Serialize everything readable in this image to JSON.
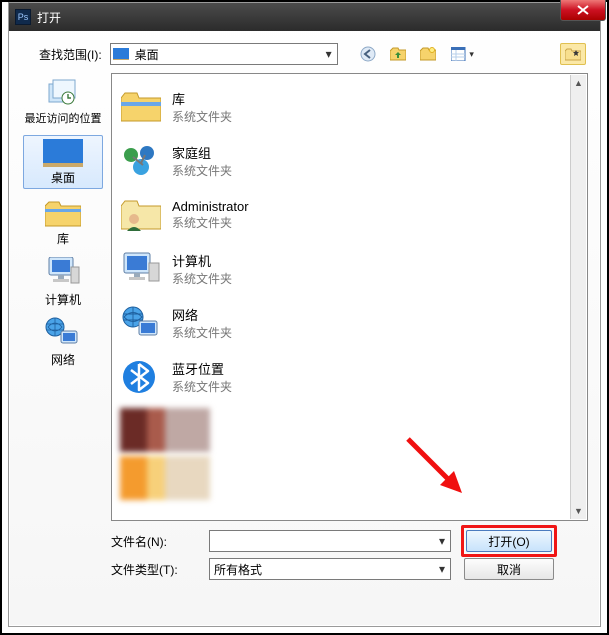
{
  "window": {
    "title": "打开",
    "app_icon_label": "Ps"
  },
  "lookin": {
    "label": "查找范围(I):",
    "value": "桌面"
  },
  "toolbar": {
    "back": "后退",
    "up": "上一级",
    "new_folder": "新建文件夹",
    "views": "视图"
  },
  "places": [
    {
      "name": "recent",
      "label": "最近访问的位置"
    },
    {
      "name": "desktop",
      "label": "桌面",
      "selected": true
    },
    {
      "name": "library",
      "label": "库"
    },
    {
      "name": "computer",
      "label": "计算机"
    },
    {
      "name": "network",
      "label": "网络"
    }
  ],
  "files": [
    {
      "name": "库",
      "sub": "系统文件夹",
      "icon": "library"
    },
    {
      "name": "家庭组",
      "sub": "系统文件夹",
      "icon": "homegroup"
    },
    {
      "name": "Administrator",
      "sub": "系统文件夹",
      "icon": "userfolder"
    },
    {
      "name": "计算机",
      "sub": "系统文件夹",
      "icon": "computer"
    },
    {
      "name": "网络",
      "sub": "系统文件夹",
      "icon": "network"
    },
    {
      "name": "蓝牙位置",
      "sub": "系统文件夹",
      "icon": "bluetooth"
    }
  ],
  "filename": {
    "label": "文件名(N):",
    "value": ""
  },
  "filetype": {
    "label": "文件类型(T):",
    "value": "所有格式"
  },
  "buttons": {
    "open": "打开(O)",
    "cancel": "取消"
  }
}
